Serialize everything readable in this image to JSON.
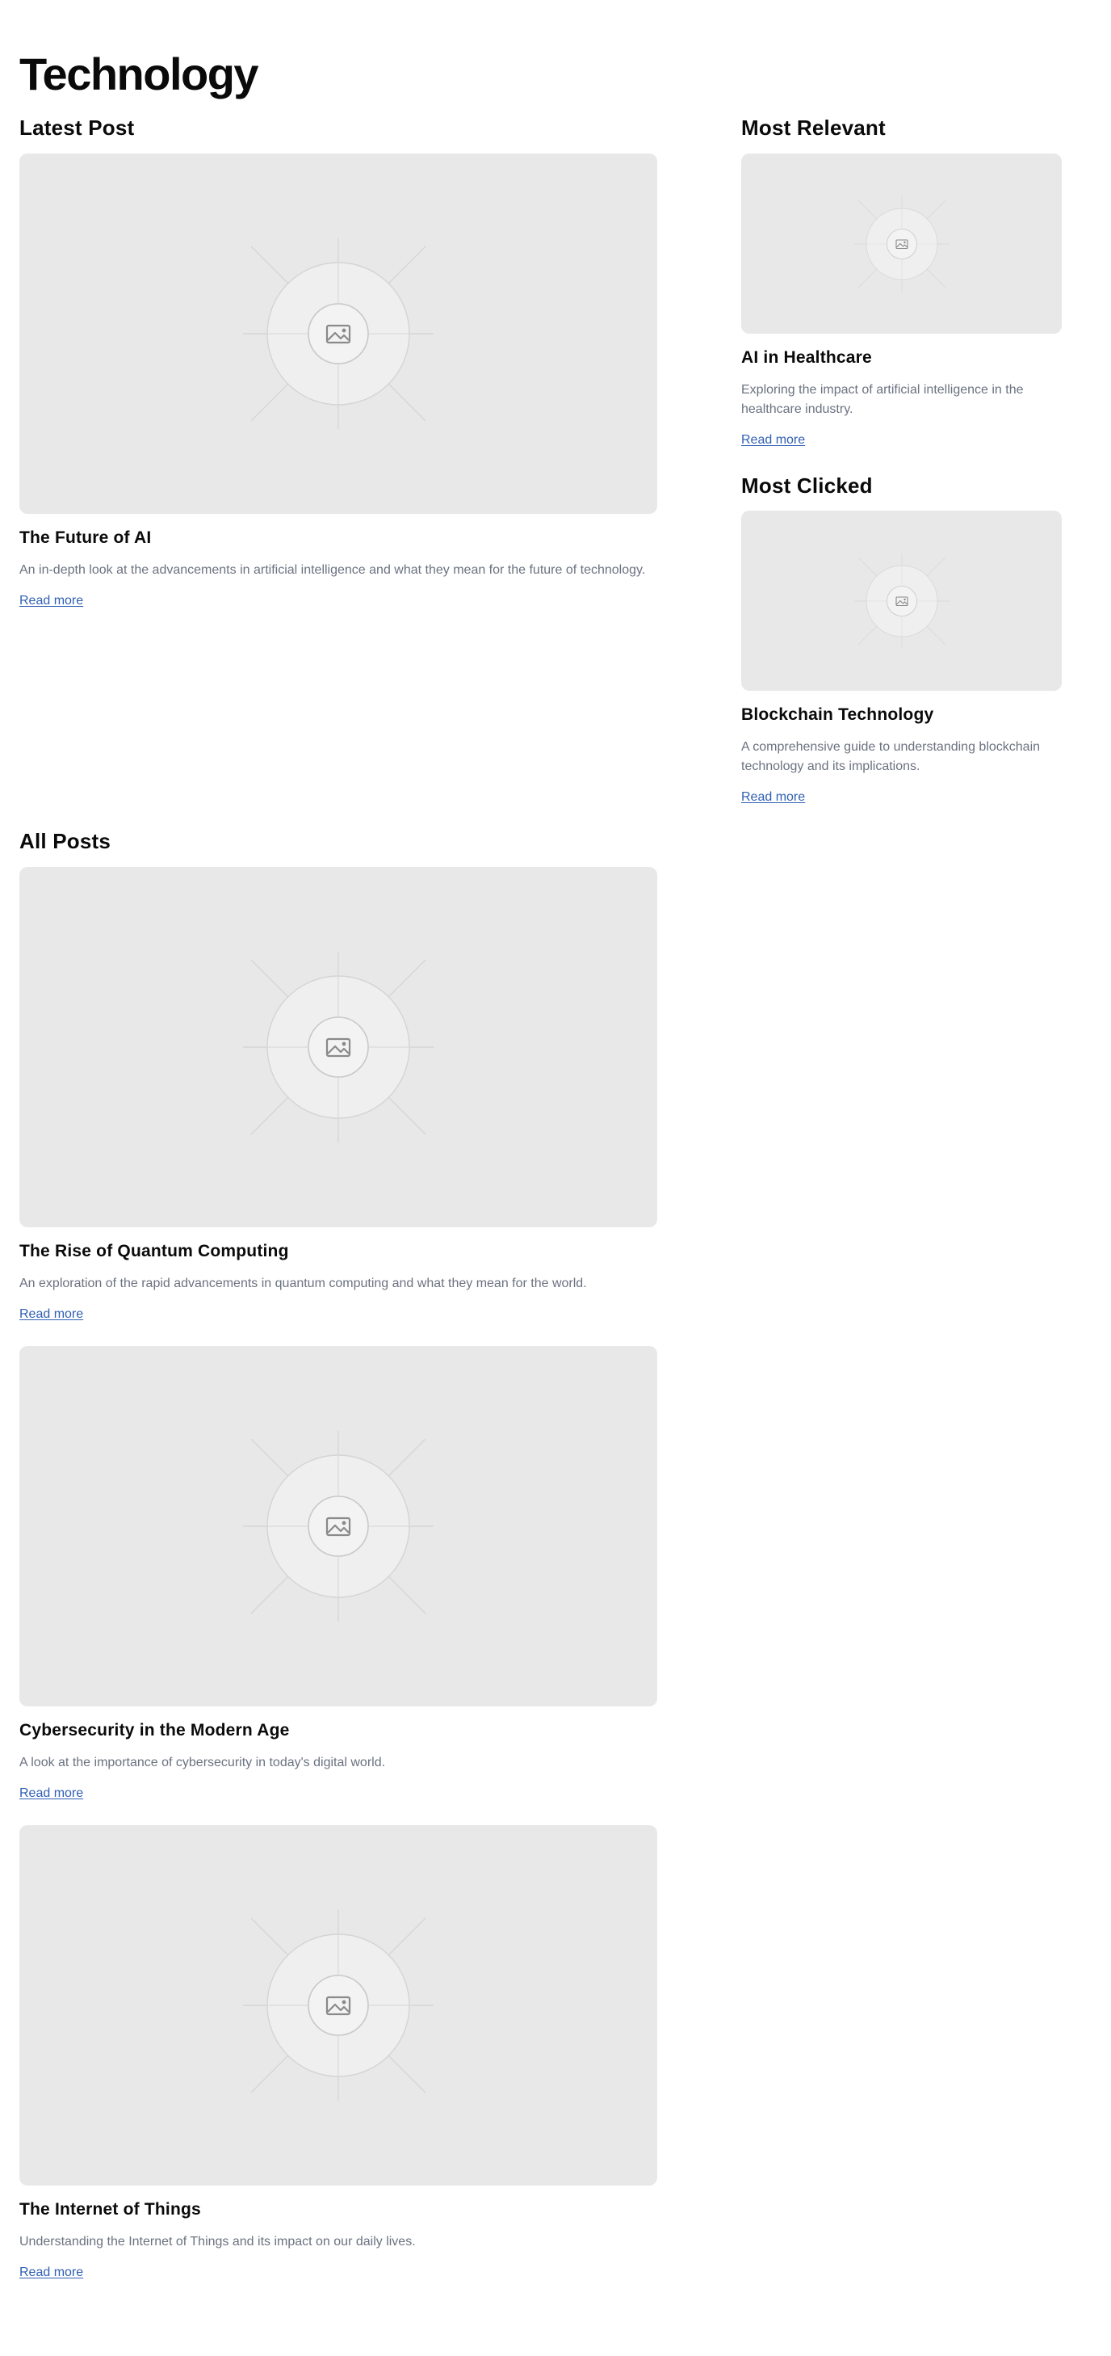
{
  "page": {
    "title": "Technology"
  },
  "sections": {
    "latest": "Latest Post",
    "relevant": "Most Relevant",
    "clicked": "Most Clicked",
    "all": "All Posts"
  },
  "latest_post": {
    "title": "The Future of AI",
    "description": "An in-depth look at the advancements in artificial intelligence and what they mean for the future of technology.",
    "link": "Read more",
    "image_icon": "image-placeholder-icon"
  },
  "most_relevant": {
    "title": "AI in Healthcare",
    "description": "Exploring the impact of artificial intelligence in the healthcare industry.",
    "link": "Read more",
    "image_icon": "image-placeholder-icon"
  },
  "most_clicked": {
    "title": "Blockchain Technology",
    "description": "A comprehensive guide to understanding blockchain technology and its implications.",
    "link": "Read more",
    "image_icon": "image-placeholder-icon"
  },
  "all_posts": [
    {
      "title": "The Rise of Quantum Computing",
      "description": "An exploration of the rapid advancements in quantum computing and what they mean for the world.",
      "link": "Read more",
      "image_icon": "image-placeholder-icon"
    },
    {
      "title": "Cybersecurity in the Modern Age",
      "description": "A look at the importance of cybersecurity in today's digital world.",
      "link": "Read more",
      "image_icon": "image-placeholder-icon"
    },
    {
      "title": "The Internet of Things",
      "description": "Understanding the Internet of Things and its impact on our daily lives.",
      "link": "Read more",
      "image_icon": "image-placeholder-icon"
    }
  ],
  "colors": {
    "placeholder_bg": "#e8e8e8",
    "link": "#2f5fb3",
    "muted_text": "#6b7280",
    "heading_text": "#0a0a0a"
  }
}
